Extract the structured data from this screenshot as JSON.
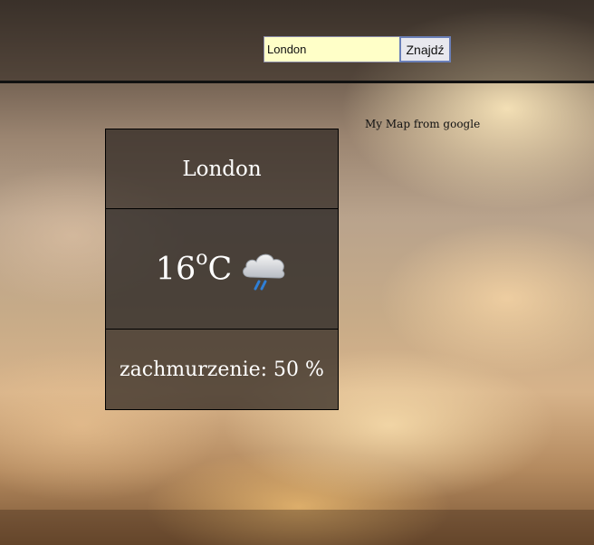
{
  "header": {
    "search": {
      "value": "London",
      "placeholder": ""
    },
    "submit_label": "Znajdź"
  },
  "map": {
    "label": "My Map from google"
  },
  "weather": {
    "city": "London",
    "temperature": "16",
    "unit_degree": "o",
    "unit_scale": "C",
    "condition_icon": "rain-cloud-icon",
    "clouds_text": "zachmurzenie: 50 %"
  },
  "colors": {
    "search_bg": "#ffffc8",
    "card_bg": "#2d2621",
    "text": "#ffffff",
    "rain": "#2f7fd6"
  }
}
